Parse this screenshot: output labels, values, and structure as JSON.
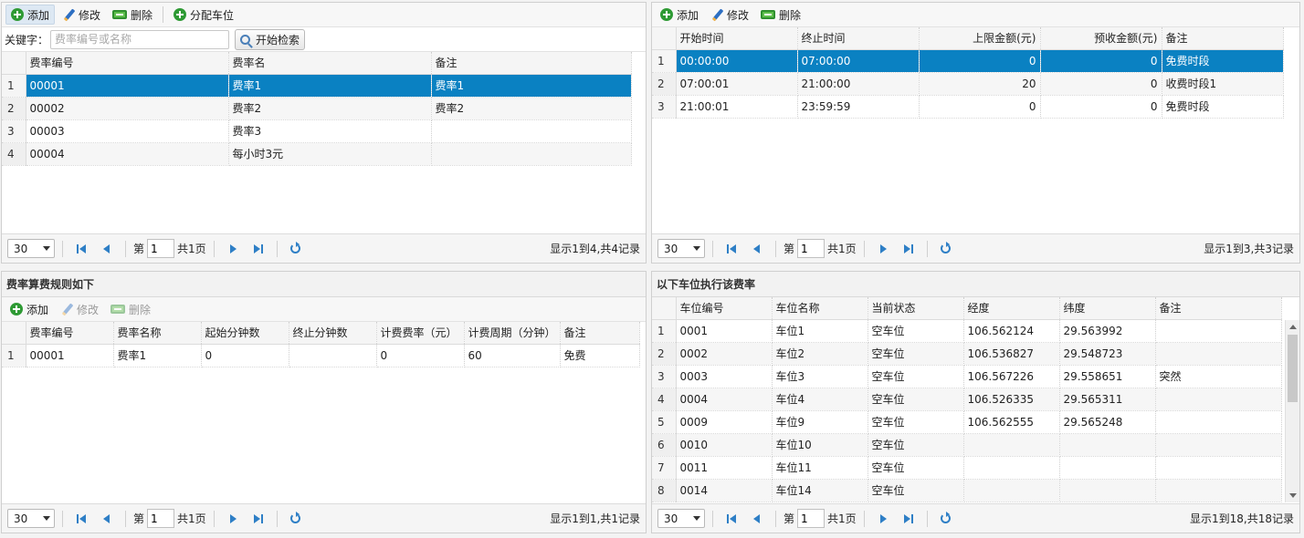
{
  "rates": {
    "toolbar": {
      "add": "添加",
      "edit": "修改",
      "delete": "删除",
      "assign": "分配车位"
    },
    "search": {
      "label": "关键字：",
      "placeholder": "费率编号或名称",
      "button": "开始检索"
    },
    "columns": [
      "费率编号",
      "费率名",
      "备注"
    ],
    "rows": [
      {
        "num": "1",
        "code": "00001",
        "name": "费率1",
        "note": "费率1"
      },
      {
        "num": "2",
        "code": "00002",
        "name": "费率2",
        "note": "费率2"
      },
      {
        "num": "3",
        "code": "00003",
        "name": "费率3",
        "note": ""
      },
      {
        "num": "4",
        "code": "00004",
        "name": "每小时3元",
        "note": ""
      }
    ],
    "pager": {
      "size": "30",
      "page_prefix": "第",
      "page": "1",
      "page_total": "共1页",
      "info": "显示1到4,共4记录"
    }
  },
  "periods": {
    "toolbar": {
      "add": "添加",
      "edit": "修改",
      "delete": "删除"
    },
    "columns": [
      "开始时间",
      "终止时间",
      "上限金额(元)",
      "预收金额(元)",
      "备注"
    ],
    "rows": [
      {
        "num": "1",
        "start": "00:00:00",
        "end": "07:00:00",
        "max": "0",
        "pre": "0",
        "note": "免费时段"
      },
      {
        "num": "2",
        "start": "07:00:01",
        "end": "21:00:00",
        "max": "20",
        "pre": "0",
        "note": "收费时段1"
      },
      {
        "num": "3",
        "start": "21:00:01",
        "end": "23:59:59",
        "max": "0",
        "pre": "0",
        "note": "免费时段"
      }
    ],
    "pager": {
      "size": "30",
      "page_prefix": "第",
      "page": "1",
      "page_total": "共1页",
      "info": "显示1到3,共3记录"
    }
  },
  "rules": {
    "title": "费率算费规则如下",
    "toolbar": {
      "add": "添加",
      "edit": "修改",
      "delete": "删除"
    },
    "columns": [
      "费率编号",
      "费率名称",
      "起始分钟数",
      "终止分钟数",
      "计费费率（元）",
      "计费周期（分钟）",
      "备注"
    ],
    "rows": [
      {
        "num": "1",
        "code": "00001",
        "name": "费率1",
        "start": "0",
        "end": "",
        "fee": "0",
        "cycle": "60",
        "note": "免费"
      }
    ],
    "pager": {
      "size": "30",
      "page_prefix": "第",
      "page": "1",
      "page_total": "共1页",
      "info": "显示1到1,共1记录"
    }
  },
  "spaces": {
    "title": "以下车位执行该费率",
    "columns": [
      "车位编号",
      "车位名称",
      "当前状态",
      "经度",
      "纬度",
      "备注"
    ],
    "rows": [
      {
        "num": "1",
        "code": "0001",
        "name": "车位1",
        "state": "空车位",
        "lng": "106.562124",
        "lat": "29.563992",
        "note": ""
      },
      {
        "num": "2",
        "code": "0002",
        "name": "车位2",
        "state": "空车位",
        "lng": "106.536827",
        "lat": "29.548723",
        "note": ""
      },
      {
        "num": "3",
        "code": "0003",
        "name": "车位3",
        "state": "空车位",
        "lng": "106.567226",
        "lat": "29.558651",
        "note": "突然"
      },
      {
        "num": "4",
        "code": "0004",
        "name": "车位4",
        "state": "空车位",
        "lng": "106.526335",
        "lat": "29.565311",
        "note": ""
      },
      {
        "num": "5",
        "code": "0009",
        "name": "车位9",
        "state": "空车位",
        "lng": "106.562555",
        "lat": "29.565248",
        "note": ""
      },
      {
        "num": "6",
        "code": "0010",
        "name": "车位10",
        "state": "空车位",
        "lng": "",
        "lat": "",
        "note": ""
      },
      {
        "num": "7",
        "code": "0011",
        "name": "车位11",
        "state": "空车位",
        "lng": "",
        "lat": "",
        "note": ""
      },
      {
        "num": "8",
        "code": "0014",
        "name": "车位14",
        "state": "空车位",
        "lng": "",
        "lat": "",
        "note": ""
      }
    ],
    "pager": {
      "size": "30",
      "page_prefix": "第",
      "page": "1",
      "page_total": "共1页",
      "info": "显示1到18,共18记录"
    }
  },
  "icons": {
    "add": "plus-circle-icon",
    "edit": "pencil-icon",
    "delete": "minus-box-icon",
    "search": "magnifier-icon",
    "first": "first-page-icon",
    "prev": "prev-page-icon",
    "next": "next-page-icon",
    "last": "last-page-icon",
    "refresh": "refresh-icon"
  },
  "colors": {
    "selection": "#0a81c2",
    "pager_icon": "#2e7fc6",
    "add_icon": "#2e9a34"
  }
}
